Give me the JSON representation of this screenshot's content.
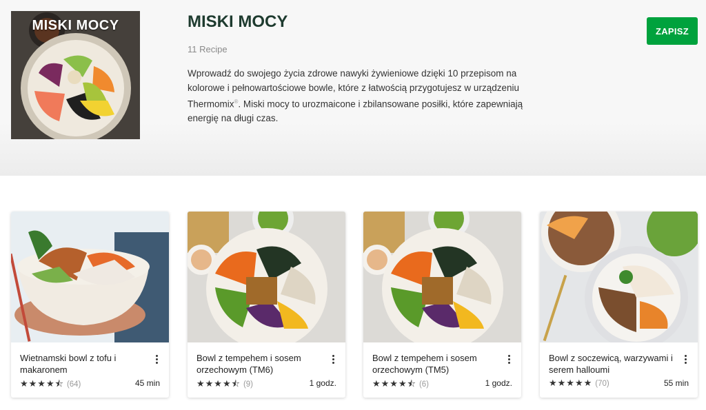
{
  "collection": {
    "cover_text": "MISKI MOCY",
    "title": "MISKI MOCY",
    "recipe_count": "11 Recipe",
    "description_before": "Wprowadź do swojego życia zdrowe nawyki żywieniowe dzięki 10 przepisom na kolorowe i pełnowartościowe bowle, które z łatwością przygotujesz w urządzeniu Thermomix",
    "description_mark": "®",
    "description_after": ". Miski mocy to urozmaicone i zbilansowane posiłki, które zapewniają energię na długi czas.",
    "save_label": "ZAPISZ"
  },
  "cards": [
    {
      "title": "Wietnamski bowl z tofu i makaronem",
      "stars": "★★★★⯪",
      "rating_count": "(64)",
      "time": "45 min"
    },
    {
      "title": "Bowl z tempehem i sosem orzechowym (TM6)",
      "stars": "★★★★⯪",
      "rating_count": "(9)",
      "time": "1 godz."
    },
    {
      "title": "Bowl z tempehem i sosem orzechowym (TM5)",
      "stars": "★★★★⯪",
      "rating_count": "(6)",
      "time": "1 godz."
    },
    {
      "title": "Bowl z soczewicą, warzywami i serem halloumi",
      "stars": "★★★★★",
      "rating_count": "(70)",
      "time": "55 min"
    }
  ],
  "colors": {
    "brand_green": "#00a23d",
    "title_green": "#1e3b2f"
  },
  "icons": {
    "menu": "more-vertical-icon",
    "star": "star-icon"
  }
}
